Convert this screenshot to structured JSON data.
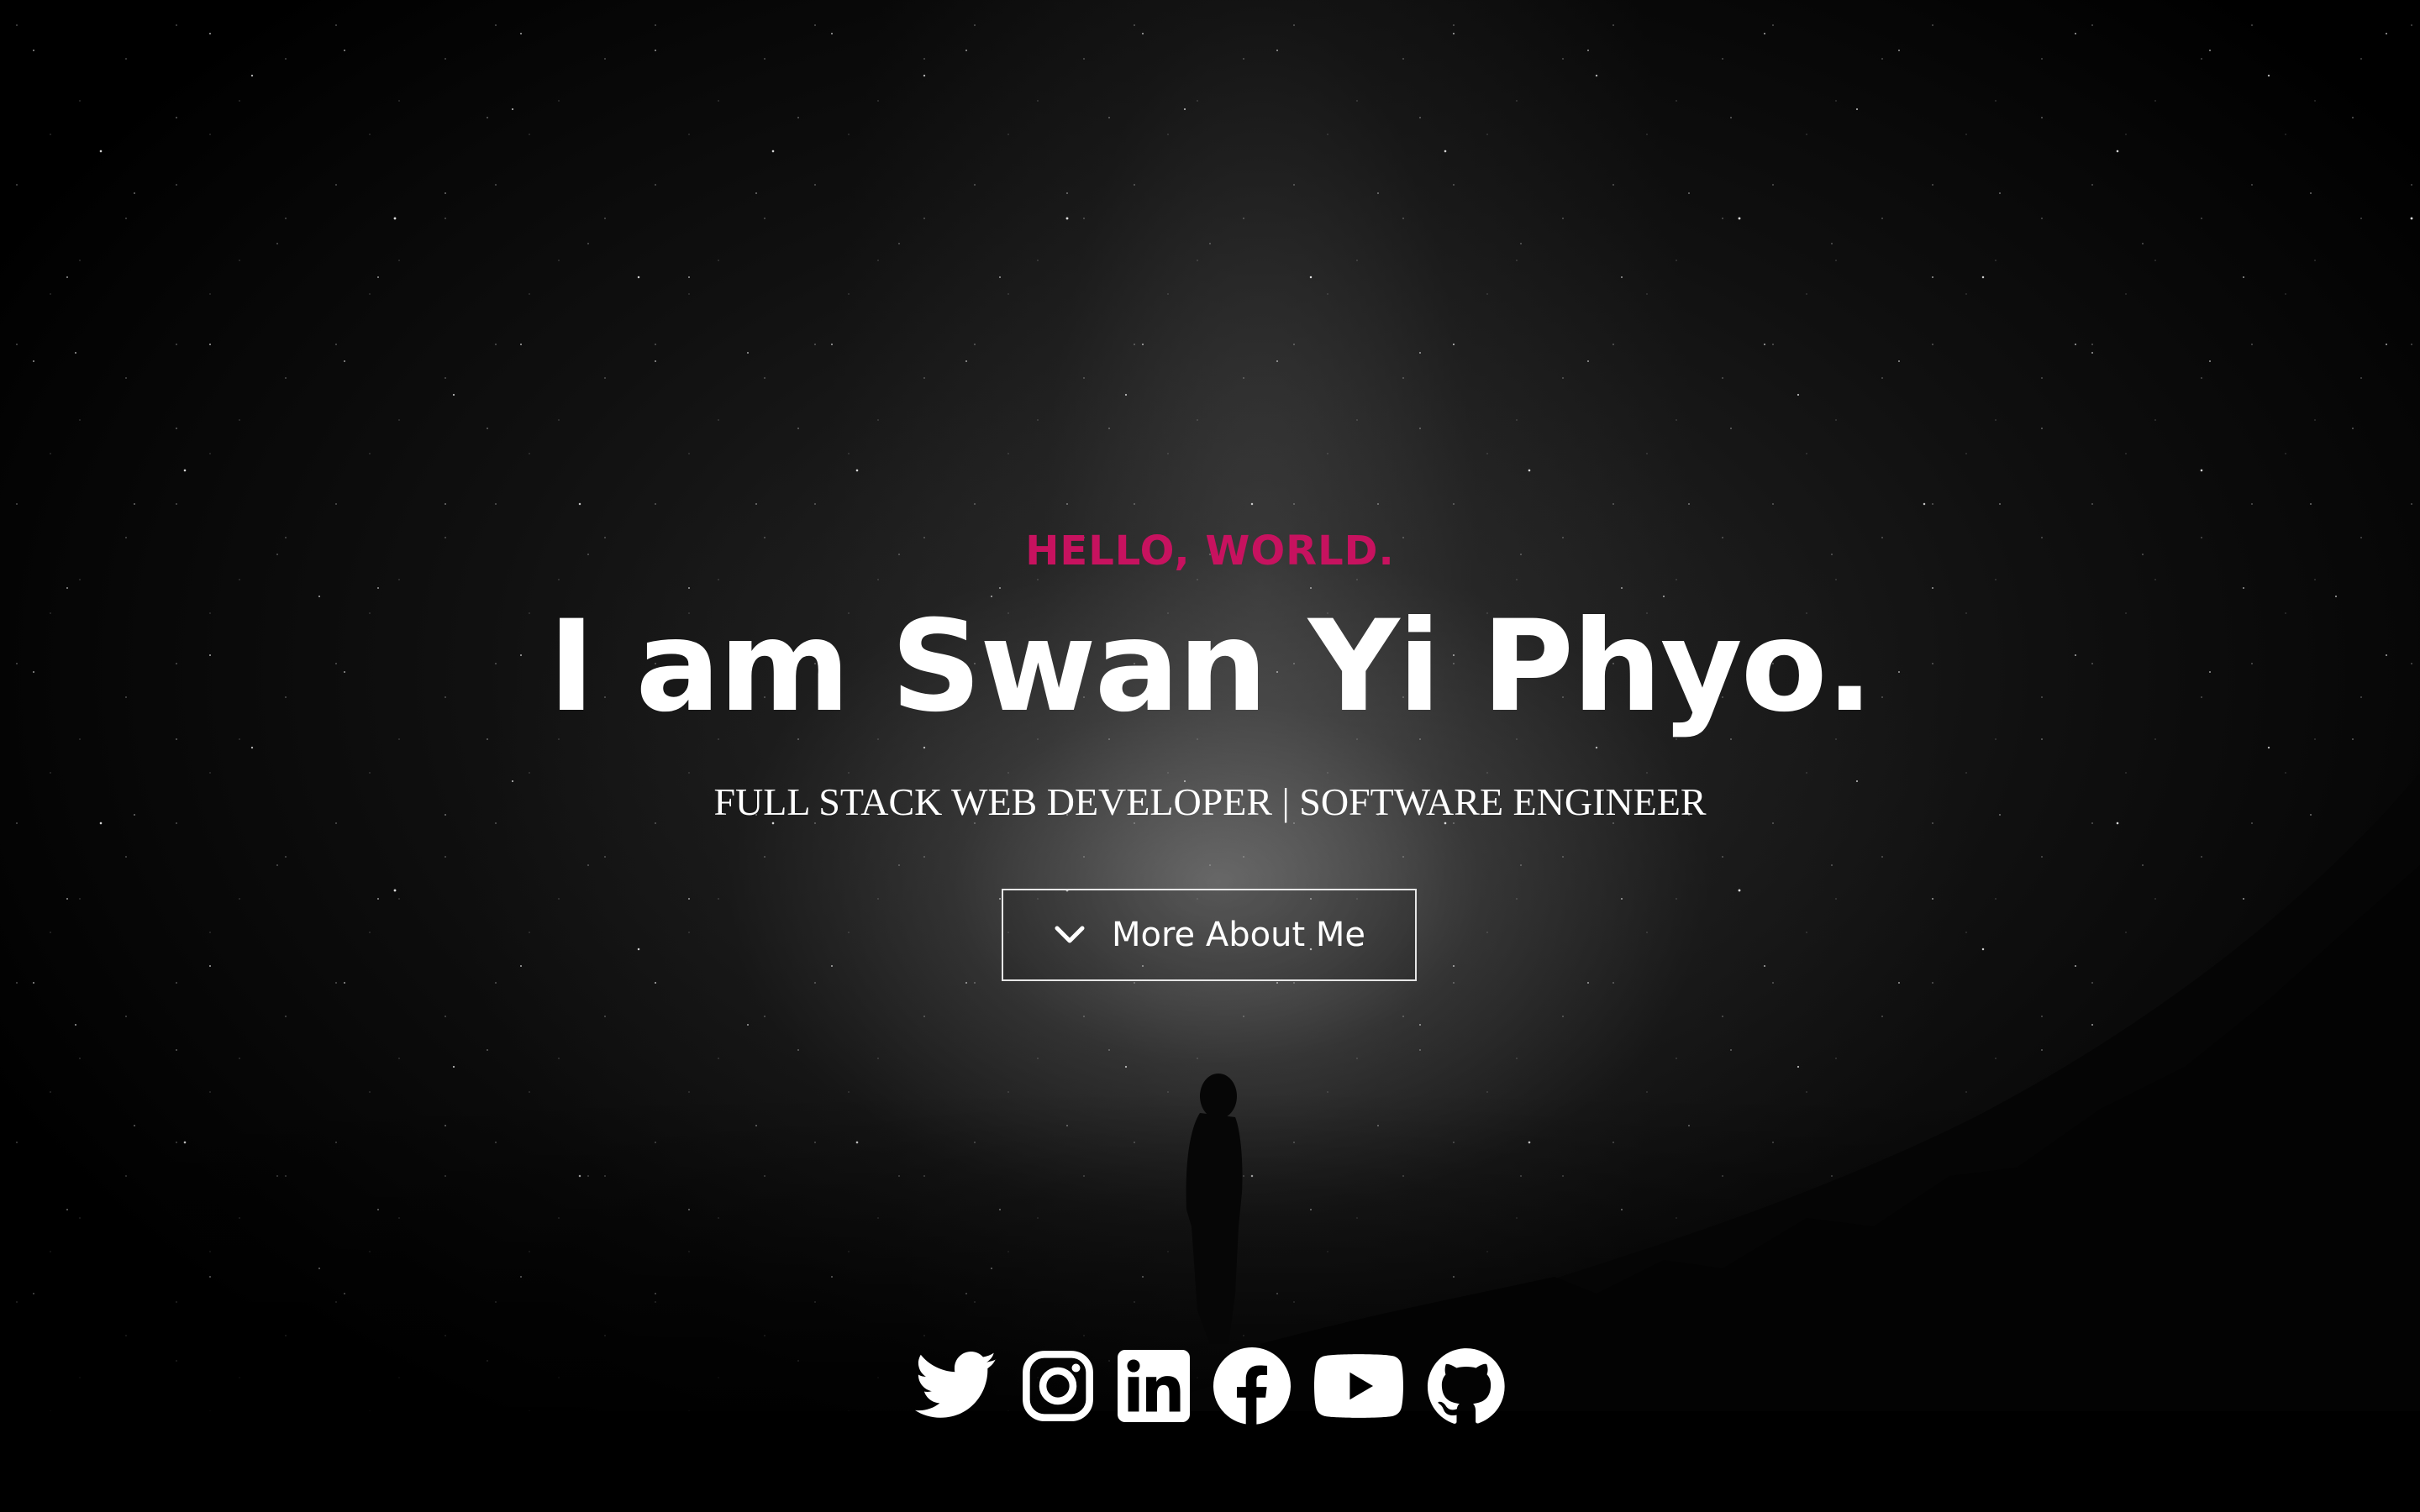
{
  "hero": {
    "greeting": "HELLO, WORLD.",
    "name": "I am Swan Yi Phyo.",
    "subtitle": "FULL STACK WEB DEVELOPER | SOFTWARE ENGINEER",
    "more_button": {
      "label": "More About Me",
      "icon": "chevron-down-icon"
    }
  },
  "social_links": [
    {
      "name": "Twitter",
      "icon": "twitter-icon"
    },
    {
      "name": "Instagram",
      "icon": "instagram-icon"
    },
    {
      "name": "LinkedIn",
      "icon": "linkedin-icon"
    },
    {
      "name": "Facebook",
      "icon": "facebook-icon"
    },
    {
      "name": "YouTube",
      "icon": "youtube-icon"
    },
    {
      "name": "GitHub",
      "icon": "github-icon"
    }
  ],
  "colors": {
    "accent": "#c7125f",
    "text": "#ffffff",
    "background": "#000000"
  }
}
